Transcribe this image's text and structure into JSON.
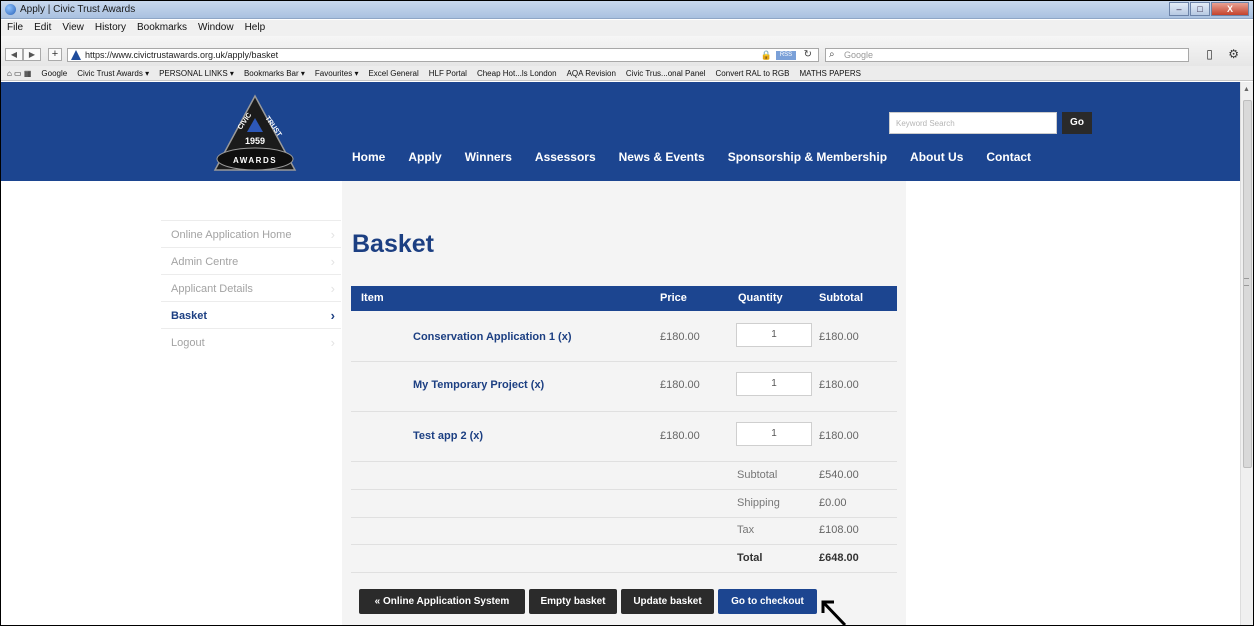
{
  "window": {
    "title": "Apply | Civic Trust Awards",
    "controls": [
      "–",
      "□",
      "X"
    ]
  },
  "menu": [
    "File",
    "Edit",
    "View",
    "History",
    "Bookmarks",
    "Window",
    "Help"
  ],
  "address": {
    "url": "https://www.civictrustawards.org.uk/apply/basket",
    "rss": "RSS",
    "search_placeholder": "Google"
  },
  "bookmarks": [
    "Google",
    "Civic Trust Awards ▾",
    "PERSONAL LINKS ▾",
    "Bookmarks Bar ▾",
    "Favourites ▾",
    "Excel General",
    "HLF Portal",
    "Cheap Hot...ls London",
    "AQA Revision",
    "Civic Trus...onal Panel",
    "Convert RAL to RGB",
    "MATHS PAPERS"
  ],
  "site": {
    "logo": {
      "top": "CIVIC",
      "right": "TRUST",
      "year": "1959",
      "bottom": "AWARDS"
    },
    "search_placeholder": "Keyword Search",
    "go_label": "Go",
    "nav": [
      "Home",
      "Apply",
      "Winners",
      "Assessors",
      "News & Events",
      "Sponsorship & Membership",
      "About Us",
      "Contact"
    ]
  },
  "sidenav": [
    {
      "label": "Online Application Home",
      "active": false
    },
    {
      "label": "Admin Centre",
      "active": false
    },
    {
      "label": "Applicant Details",
      "active": false
    },
    {
      "label": "Basket",
      "active": true
    },
    {
      "label": "Logout",
      "active": false
    }
  ],
  "basket": {
    "title": "Basket",
    "columns": {
      "item": "Item",
      "price": "Price",
      "quantity": "Quantity",
      "subtotal": "Subtotal"
    },
    "items": [
      {
        "name": "Conservation Application 1 (x)",
        "price": "£180.00",
        "quantity": "1",
        "subtotal": "£180.00"
      },
      {
        "name": "My Temporary Project (x)",
        "price": "£180.00",
        "quantity": "1",
        "subtotal": "£180.00"
      },
      {
        "name": "Test app 2 (x)",
        "price": "£180.00",
        "quantity": "1",
        "subtotal": "£180.00"
      }
    ],
    "totals": [
      {
        "label": "Subtotal",
        "value": "£540.00"
      },
      {
        "label": "Shipping",
        "value": "£0.00"
      },
      {
        "label": "Tax",
        "value": "£108.00"
      },
      {
        "label": "Total",
        "value": "£648.00"
      }
    ],
    "buttons": {
      "online_app": "« Online Application System",
      "empty": "Empty basket",
      "update": "Update basket",
      "checkout": "Go to checkout"
    }
  }
}
